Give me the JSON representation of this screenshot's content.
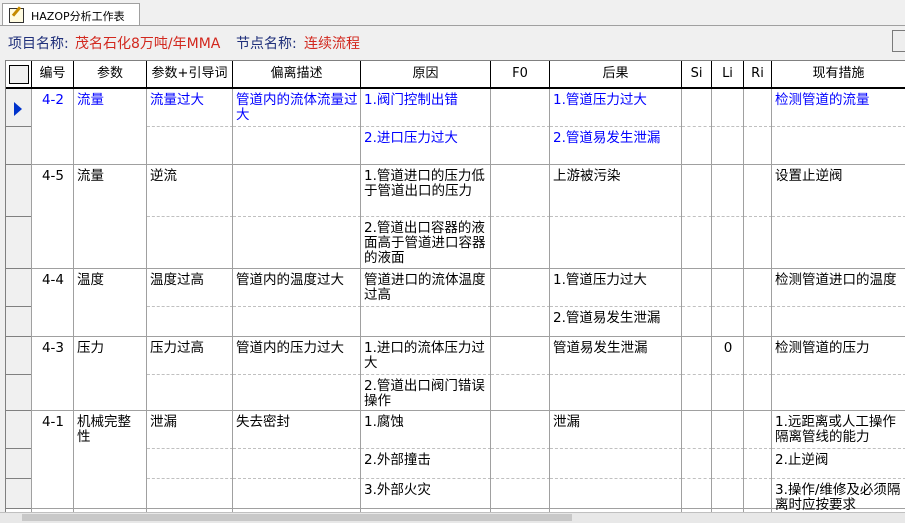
{
  "tab": {
    "label": "HAZOP分析工作表",
    "icon": "edit-icon"
  },
  "info": {
    "project_label": "项目名称:",
    "project_value": "茂名石化8万吨/年MMA",
    "node_label": "节点名称:",
    "node_value": "连续流程"
  },
  "columns": [
    "编号",
    "参数",
    "参数+引导词",
    "偏离描述",
    "原因",
    "F0",
    "后果",
    "Si",
    "Li",
    "Ri",
    "现有措施"
  ],
  "rows": [
    {
      "id": "4-2",
      "param": "流量",
      "guide": "流量过大",
      "dev": "管道内的流体流量过大",
      "causes": [
        "1.阀门控制出错",
        "2.进口压力过大"
      ],
      "f0": "",
      "conseq": [
        "1.管道压力过大",
        "2.管道易发生泄漏"
      ],
      "si": "",
      "li": "",
      "ri": "",
      "measures": [
        "检测管道的流量",
        ""
      ]
    },
    {
      "id": "4-5",
      "param": "流量",
      "guide": "逆流",
      "dev": "",
      "causes": [
        "1.管道进口的压力低于管道出口的压力",
        "2.管道出口容器的液面高于管道进口容器的液面"
      ],
      "f0": "",
      "conseq": [
        "上游被污染",
        ""
      ],
      "si": "",
      "li": "",
      "ri": "",
      "measures": [
        "设置止逆阀",
        ""
      ]
    },
    {
      "id": "4-4",
      "param": "温度",
      "guide": "温度过高",
      "dev": "管道内的温度过大",
      "causes": [
        "管道进口的流体温度过高",
        ""
      ],
      "f0": "",
      "conseq": [
        "1.管道压力过大",
        "2.管道易发生泄漏"
      ],
      "si": "",
      "li": "",
      "ri": "",
      "measures": [
        "检测管道进口的温度",
        ""
      ]
    },
    {
      "id": "4-3",
      "param": "压力",
      "guide": "压力过高",
      "dev": "管道内的压力过大",
      "causes": [
        "1.进口的流体压力过大",
        "2.管道出口阀门错误操作"
      ],
      "f0": "",
      "conseq": [
        "管道易发生泄漏",
        ""
      ],
      "si": "",
      "li": "0",
      "ri": "",
      "measures": [
        "检测管道的压力",
        ""
      ]
    },
    {
      "id": "4-1",
      "param": "机械完整性",
      "guide": "泄漏",
      "dev": "失去密封",
      "causes": [
        "1.腐蚀",
        "2.外部撞击",
        "3.外部火灾"
      ],
      "f0": "",
      "conseq": [
        "泄漏",
        "",
        ""
      ],
      "si": "",
      "li": "",
      "ri": "",
      "measures": [
        "1.远距离或人工操作隔离管线的能力",
        "2.止逆阀",
        "3.操作/维修及必须隔离时应按要求"
      ]
    }
  ]
}
